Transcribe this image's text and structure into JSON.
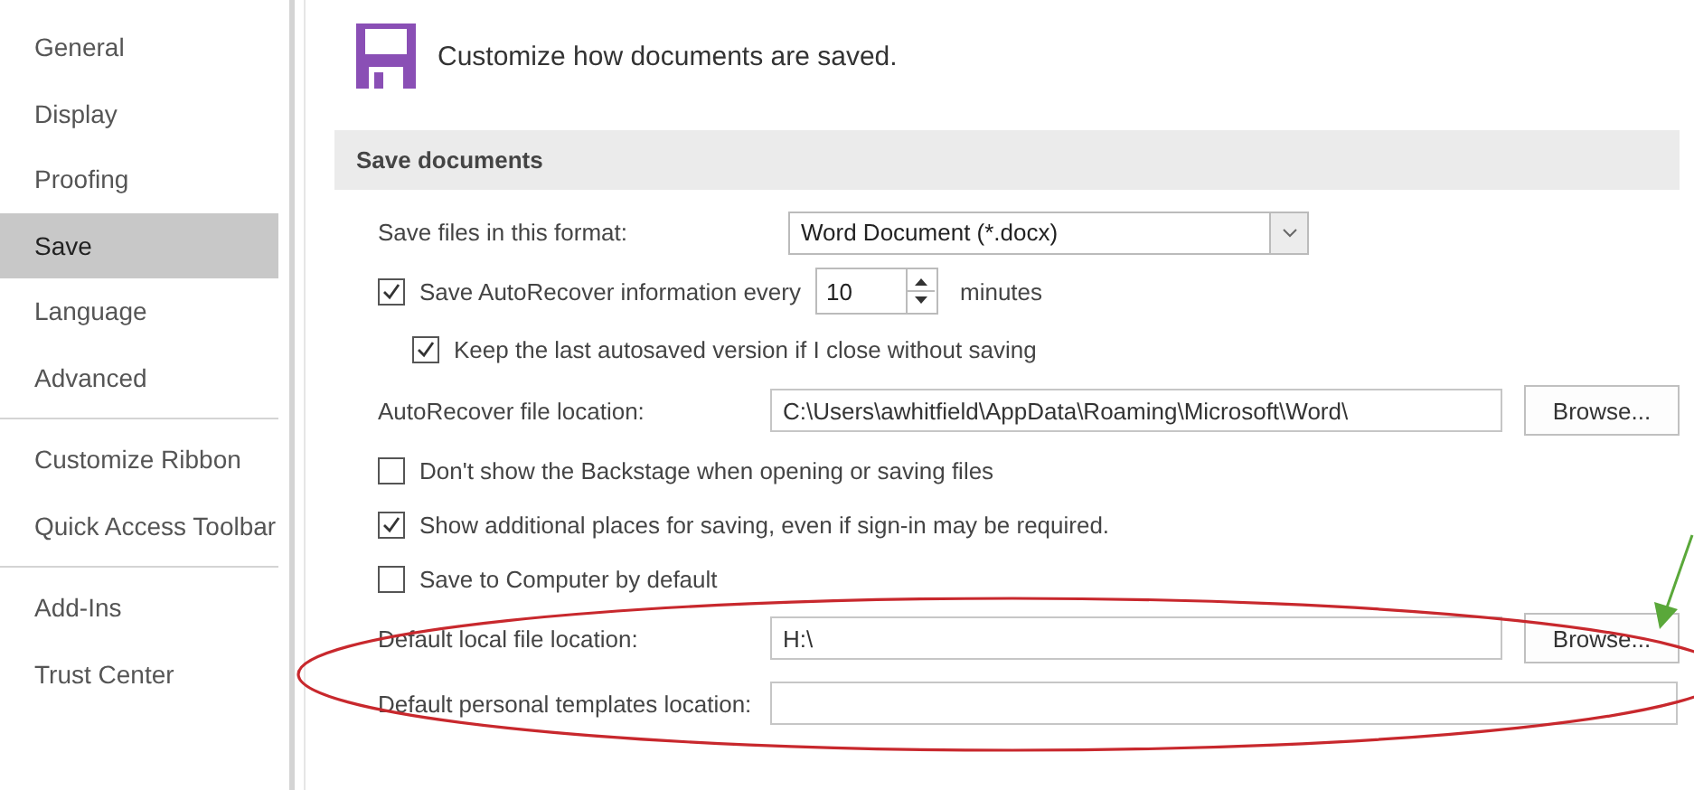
{
  "sidebar": {
    "groups": [
      [
        {
          "label": "General",
          "selected": false
        },
        {
          "label": "Display",
          "selected": false
        },
        {
          "label": "Proofing",
          "selected": false
        },
        {
          "label": "Save",
          "selected": true
        },
        {
          "label": "Language",
          "selected": false
        },
        {
          "label": "Advanced",
          "selected": false
        }
      ],
      [
        {
          "label": "Customize Ribbon",
          "selected": false
        },
        {
          "label": "Quick Access Toolbar",
          "selected": false
        }
      ],
      [
        {
          "label": "Add-Ins",
          "selected": false
        },
        {
          "label": "Trust Center",
          "selected": false
        }
      ]
    ]
  },
  "header": {
    "text": "Customize how documents are saved."
  },
  "section": {
    "title": "Save documents"
  },
  "rows": [
    {
      "kind": "select",
      "label": "Save files in this format:",
      "value": "Word Document (*.docx)"
    },
    {
      "kind": "spin",
      "label": "Save AutoRecover information every",
      "checked": true,
      "value": "10",
      "unit": "minutes"
    },
    {
      "kind": "check",
      "label": "Keep the last autosaved version if I close without saving",
      "checked": true,
      "indented": true
    },
    {
      "kind": "path",
      "label": "AutoRecover file location:",
      "value": "C:\\Users\\awhitfield\\AppData\\Roaming\\Microsoft\\Word\\",
      "button": "Browse..."
    },
    {
      "kind": "check",
      "label": "Don't show the Backstage when opening or saving files",
      "checked": false
    },
    {
      "kind": "check",
      "label": "Show additional places for saving, even if sign-in may be required.",
      "checked": true
    },
    {
      "kind": "check",
      "label": "Save to Computer by default",
      "checked": false
    },
    {
      "kind": "path",
      "label": "Default local file location:",
      "value": "H:\\",
      "button": "Browse..."
    },
    {
      "kind": "path",
      "label": "Default personal templates location:"
    }
  ]
}
